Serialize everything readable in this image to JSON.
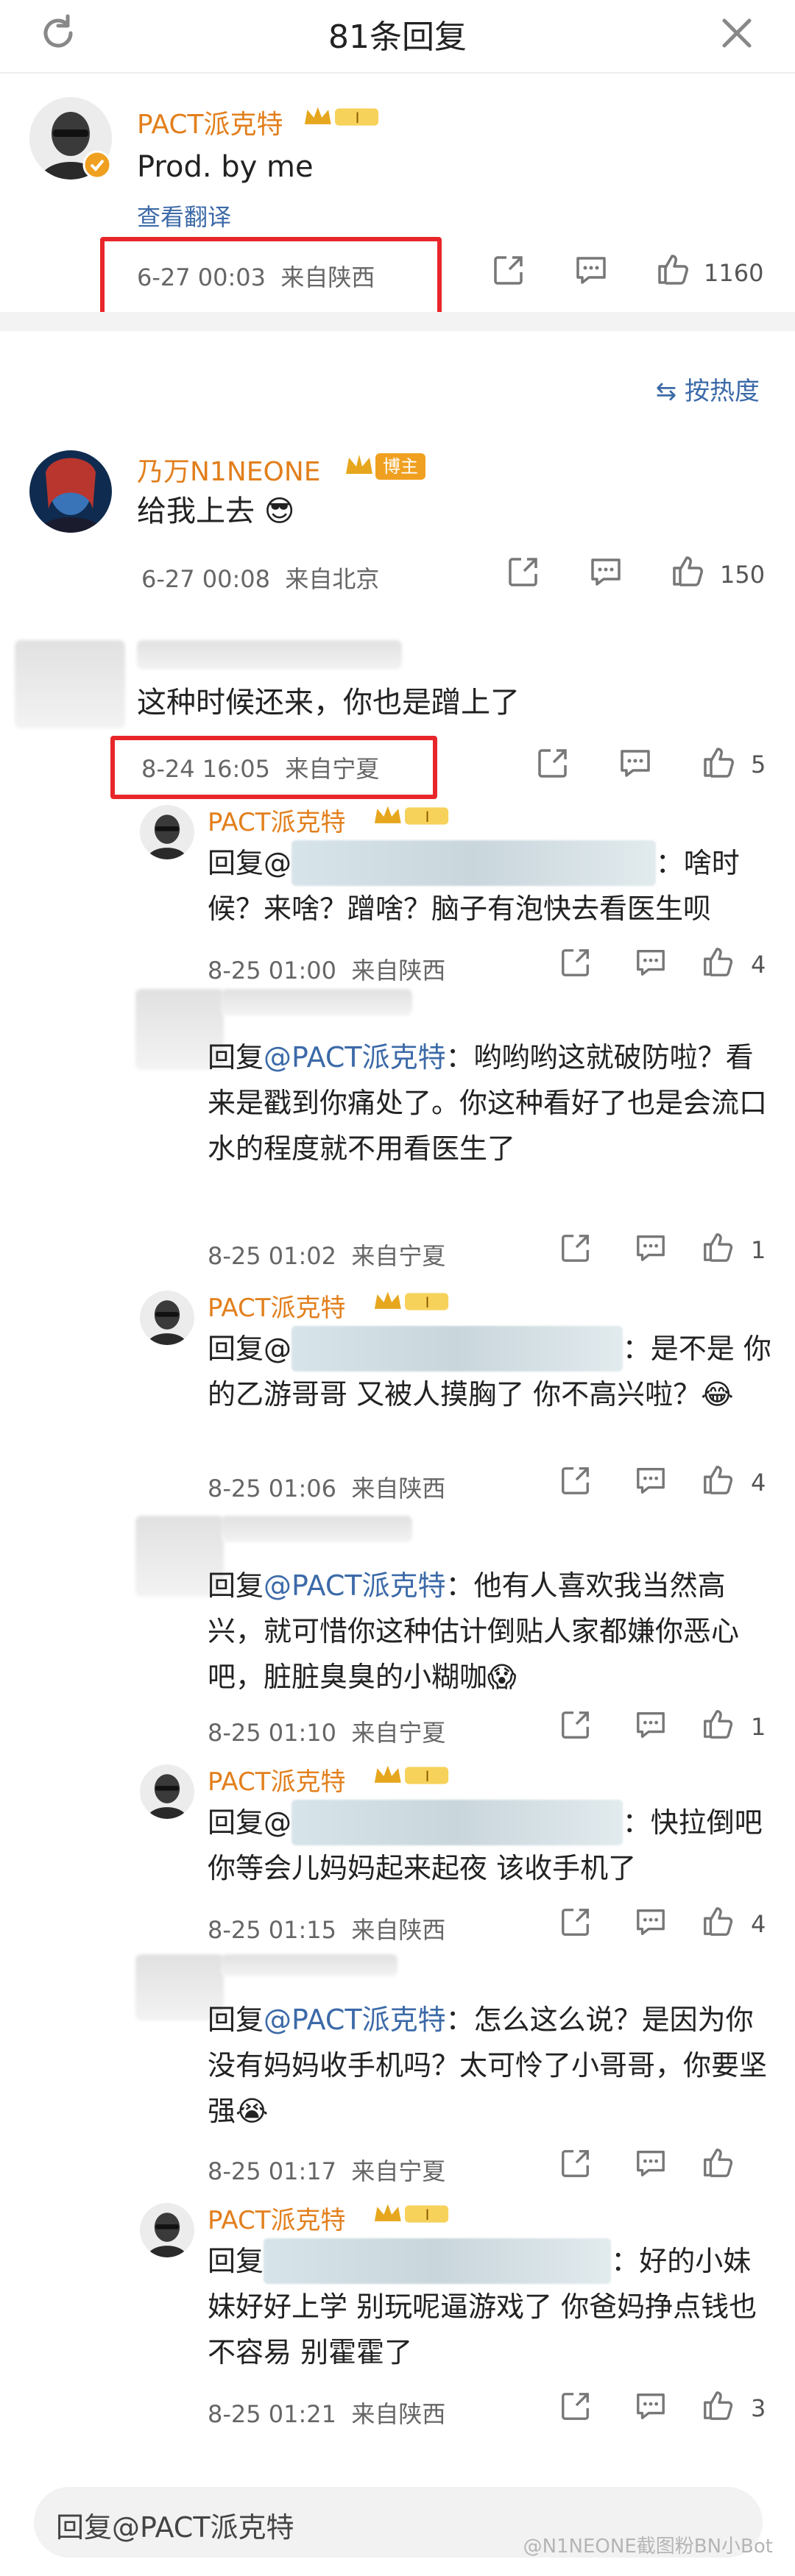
{
  "header": {
    "title": "81条回复"
  },
  "main": {
    "author": "PACT派克特",
    "text": "Prod. by me",
    "translate": "查看翻译",
    "time": "6-27 00:03",
    "location": "来自陕西",
    "likes": "1160"
  },
  "sort_label": "按热度",
  "replies": [
    {
      "name": "乃万N1NEONE",
      "badge": "博主",
      "text": "给我上去 😎",
      "time": "6-27 00:08",
      "location": "来自北京",
      "likes": "150"
    },
    {
      "name": "",
      "text": "这种时候还来，你也是蹭上了",
      "time": "8-24 16:05",
      "location": "来自宁夏",
      "likes": "5"
    }
  ],
  "subreplies": [
    {
      "name": "PACT派克特",
      "prefix": "回复@",
      "text": "：啥时候？来啥？蹭啥？脑子有泡快去看医生呗",
      "time": "8-25 01:00",
      "location": "来自陕西",
      "likes": "4"
    },
    {
      "name": "",
      "prefix": "回复",
      "mention": "@PACT派克特",
      "text": "：哟哟哟这就破防啦？看来是戳到你痛处了。你这种看好了也是会流口水的程度就不用看医生了",
      "time": "8-25 01:02",
      "location": "来自宁夏",
      "likes": "1"
    },
    {
      "name": "PACT派克特",
      "prefix": "回复@",
      "text": "：是不是 你的乙游哥哥 又被人摸胸了 你不高兴啦？😂",
      "time": "8-25 01:06",
      "location": "来自陕西",
      "likes": "4"
    },
    {
      "name": "",
      "prefix": "回复",
      "mention": "@PACT派克特",
      "text": "：他有人喜欢我当然高兴，就可惜你这种估计倒贴人家都嫌你恶心吧，脏脏臭臭的小糊咖😱",
      "time": "8-25 01:10",
      "location": "来自宁夏",
      "likes": "1"
    },
    {
      "name": "PACT派克特",
      "prefix": "回复@",
      "text": "：快拉倒吧你等会儿妈妈起来起夜 该收手机了",
      "time": "8-25 01:15",
      "location": "来自陕西",
      "likes": "4"
    },
    {
      "name": "",
      "prefix": "回复",
      "mention": "@PACT派克特",
      "text": "：怎么这么说？是因为你没有妈妈收手机吗？太可怜了小哥哥，你要坚强😭",
      "time": "8-25 01:17",
      "location": "来自宁夏",
      "likes": ""
    },
    {
      "name": "PACT派克特",
      "prefix": "回复",
      "text": "：好的小妹妹好好上学 别玩呢逼游戏了 你爸妈挣点钱也不容易 别霍霍了",
      "time": "8-25 01:21",
      "location": "来自陕西",
      "likes": "3"
    }
  ],
  "footer": {
    "reply_placeholder": "回复@PACT派克特"
  },
  "watermark": "@N1NEONE截图粉BN小Bot",
  "colors": {
    "name": "#e27f1c",
    "link": "#3c6aa8",
    "highlight": "#e8262a",
    "background": "#ffffff"
  }
}
